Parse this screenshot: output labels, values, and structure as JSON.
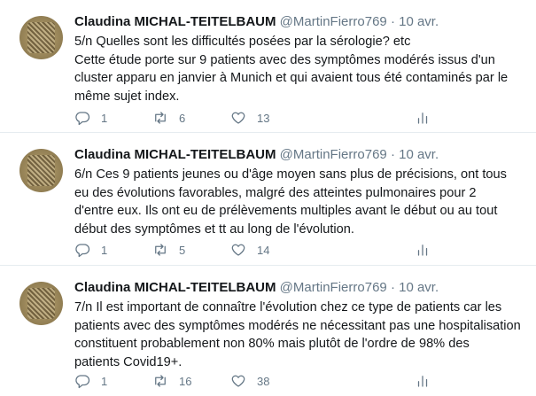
{
  "tweets": [
    {
      "author_name": "Claudina MICHAL-TEITELBAUM",
      "handle": "@MartinFierro769",
      "separator": "·",
      "date": "10 avr.",
      "lines": [
        "5/n Quelles sont les difficultés posées par la sérologie? etc",
        "Cette étude porte sur 9 patients avec des symptômes modérés issus d'un",
        "cluster apparu en janvier à Munich et qui avaient tous été contaminés par le",
        "même sujet index."
      ],
      "replies": "1",
      "retweets": "6",
      "likes": "13"
    },
    {
      "author_name": "Claudina MICHAL-TEITELBAUM",
      "handle": "@MartinFierro769",
      "separator": "·",
      "date": "10 avr.",
      "lines": [
        "6/n Ces 9 patients jeunes ou d'âge moyen sans plus de précisions, ont tous",
        "eu des évolutions favorables, malgré des  atteintes pulmonaires pour 2",
        "d'entre eux. Ils ont eu de prélèvements multiples avant le début ou au tout",
        "début des symptômes et tt au long de l'évolution."
      ],
      "replies": "1",
      "retweets": "5",
      "likes": "14"
    },
    {
      "author_name": "Claudina MICHAL-TEITELBAUM",
      "handle": "@MartinFierro769",
      "separator": "·",
      "date": "10 avr.",
      "lines": [
        "7/n Il est important de connaître l'évolution chez ce type de patients car les",
        "patients avec des symptômes modérés ne nécessitant pas une hospitalisation",
        "constituent probablement non 80% mais plutôt de l'ordre de 98% des",
        "patients Covid19+."
      ],
      "replies": "1",
      "retweets": "16",
      "likes": "38"
    }
  ],
  "icons": {
    "reply": "reply-icon",
    "retweet": "retweet-icon",
    "like": "heart-icon",
    "stats": "analytics-icon"
  },
  "colors": {
    "text": "#14171a",
    "secondary": "#657786",
    "divider": "#e6ecf0"
  }
}
